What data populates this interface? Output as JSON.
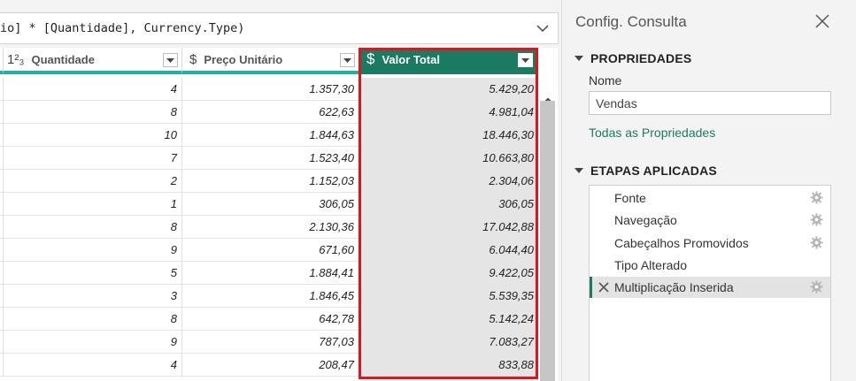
{
  "formula": {
    "text": "io] * [Quantidade], Currency.Type)"
  },
  "columns": [
    {
      "type_icon": "1²₃",
      "name": "Quantidade"
    },
    {
      "type_icon": "$",
      "name": "Preço Unitário"
    },
    {
      "type_icon": "$",
      "name": "Valor Total"
    }
  ],
  "rows": [
    {
      "q": "4",
      "p": "1.357,30",
      "v": "5.429,20"
    },
    {
      "q": "8",
      "p": "622,63",
      "v": "4.981,04"
    },
    {
      "q": "10",
      "p": "1.844,63",
      "v": "18.446,30"
    },
    {
      "q": "7",
      "p": "1.523,40",
      "v": "10.663,80"
    },
    {
      "q": "2",
      "p": "1.152,03",
      "v": "2.304,06"
    },
    {
      "q": "1",
      "p": "306,05",
      "v": "306,05"
    },
    {
      "q": "8",
      "p": "2.130,36",
      "v": "17.042,88"
    },
    {
      "q": "9",
      "p": "671,60",
      "v": "6.044,40"
    },
    {
      "q": "5",
      "p": "1.884,41",
      "v": "9.422,05"
    },
    {
      "q": "3",
      "p": "1.846,45",
      "v": "5.539,35"
    },
    {
      "q": "8",
      "p": "642,78",
      "v": "5.142,24"
    },
    {
      "q": "9",
      "p": "787,03",
      "v": "7.083,27"
    },
    {
      "q": "4",
      "p": "208,47",
      "v": "833,88"
    }
  ],
  "panel": {
    "title": "Config. Consulta",
    "properties_header": "PROPRIEDADES",
    "name_label": "Nome",
    "name_value": "Vendas",
    "all_properties": "Todas as Propriedades",
    "steps_header": "ETAPAS APLICADAS",
    "steps": [
      {
        "label": "Fonte",
        "gear": true
      },
      {
        "label": "Navegação",
        "gear": true
      },
      {
        "label": "Cabeçalhos Promovidos",
        "gear": true
      },
      {
        "label": "Tipo Alterado",
        "gear": false
      },
      {
        "label": "Multiplicação Inserida",
        "gear": true,
        "active": true
      }
    ]
  },
  "colors": {
    "accent": "#1b7a62",
    "header_rule": "#1eb2a6",
    "highlight": "#e8101b"
  }
}
